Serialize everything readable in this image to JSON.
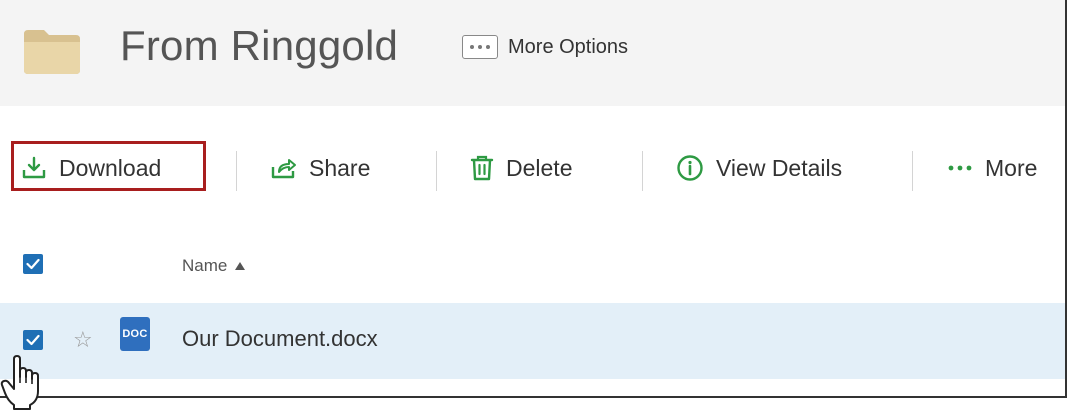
{
  "header": {
    "folder_title": "From Ringgold",
    "more_options_label": "More Options"
  },
  "toolbar": {
    "download_label": "Download",
    "share_label": "Share",
    "delete_label": "Delete",
    "view_details_label": "View Details",
    "more_label": "More"
  },
  "list": {
    "name_column": "Name",
    "select_all_checked": true,
    "rows": [
      {
        "type_badge": "DOC",
        "name": "Our Document.docx",
        "checked": true,
        "starred": false
      }
    ]
  },
  "colors": {
    "accent_green": "#2e9a43",
    "highlight_red": "#a81e1e",
    "checkbox_blue": "#1f6fb5",
    "row_selected": "#e3eff8",
    "doc_blue": "#2f6fbe"
  }
}
